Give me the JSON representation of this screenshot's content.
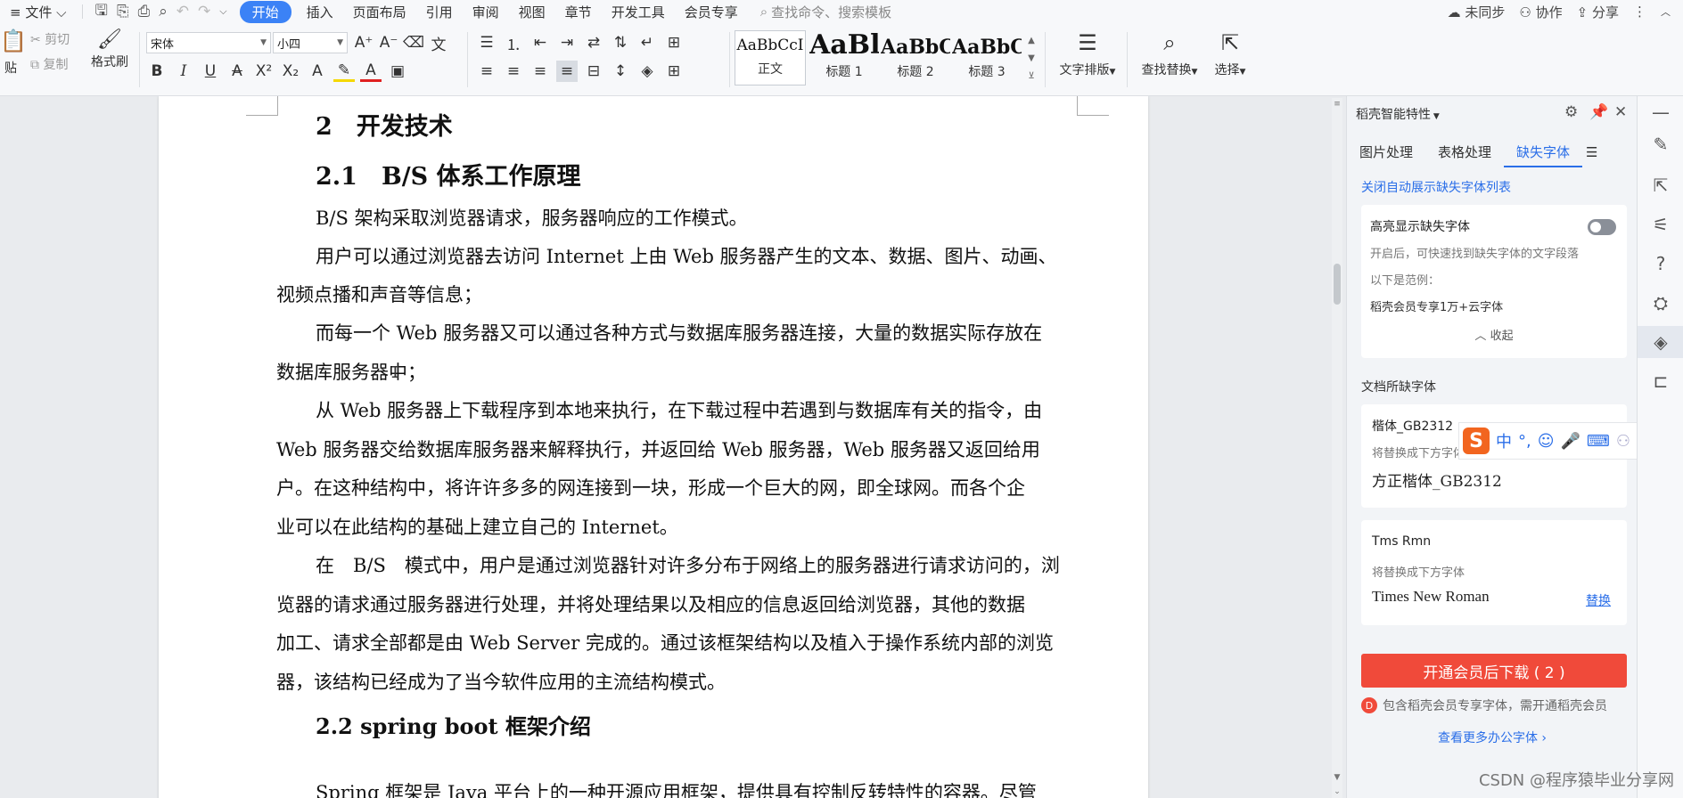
{
  "menubar": {
    "file": "文件",
    "tabs": [
      "开始",
      "插入",
      "页面布局",
      "引用",
      "审阅",
      "视图",
      "章节",
      "开发工具",
      "会员专享"
    ],
    "active_tab": "开始",
    "search_placeholder": "查找命令、搜索模板",
    "sync": "未同步",
    "collab": "协作",
    "share": "分享"
  },
  "ribbon": {
    "paste": "贴",
    "cut": "剪切",
    "copy": "复制",
    "format_painter": "格式刷",
    "font_name": "宋体",
    "font_size": "小四",
    "styles": [
      {
        "preview": "AaBbCcI",
        "label": "正文"
      },
      {
        "preview": "AaBl",
        "label": "标题 1"
      },
      {
        "preview": "AaBbC",
        "label": "标题 2"
      },
      {
        "preview": "AaBbC",
        "label": "标题 3"
      }
    ],
    "text_layout": "文字排版",
    "find_replace": "查找替换",
    "select": "选择"
  },
  "document": {
    "h_chapter": "2　开发技术",
    "h_section": "2.1　B/S 体系工作原理",
    "lines": [
      "B/S 架构采取浏览器请求，服务器响应的工作模式。",
      "用户可以通过浏览器去访问 Internet 上由 Web 服务器产生的文本、数据、图片、动画、",
      "视频点播和声音等信息；",
      "而每一个 Web 服务器又可以通过各种方式与数据库服务器连接，大量的数据实际存放在",
      "数据库服务器中；",
      "从 Web 服务器上下载程序到本地来执行，在下载过程中若遇到与数据库有关的指令，由",
      "Web 服务器交给数据库服务器来解释执行，并返回给 Web 服务器，Web 服务器又返回给用",
      "户。在这种结构中，将许许多多的网连接到一块，形成一个巨大的网，即全球网。而各个企",
      "业可以在此结构的基础上建立自己的 Internet。",
      "在　B/S　模式中，用户是通过浏览器针对许多分布于网络上的服务器进行请求访问的，浏",
      "览器的请求通过服务器进行处理，并将处理结果以及相应的信息返回给浏览器，其他的数据",
      "加工、请求全部都是由 Web Server 完成的。通过该框架结构以及植入于操作系统内部的浏览",
      "器，该结构已经成为了当今软件应用的主流结构模式。"
    ],
    "h_sub": "2.2 spring boot 框架介绍",
    "last_line": "Spring 框架是 Java 平台上的一种开源应用框架，提供具有控制反转特性的容器。尽管"
  },
  "pane": {
    "title": "稻壳智能特性",
    "tabs": [
      "图片处理",
      "表格处理",
      "缺失字体"
    ],
    "active_tab": "缺失字体",
    "close_auto_link": "关闭自动展示缺失字体列表",
    "highlight_title": "高亮显示缺失字体",
    "highlight_desc": "开启后，可快速找到缺失字体的文字段落",
    "example_label": "以下是范例：",
    "example_value": "稻壳会员专享1万+云字体",
    "collapse": "收起",
    "missing_title": "文档所缺字体",
    "missing_fonts": [
      {
        "name": "楷体_GB2312",
        "replace_label": "将替换成下方字体",
        "replacement": "方正楷体_GB2312"
      },
      {
        "name": "Tms Rmn",
        "replace_label": "将替换成下方字体",
        "replacement": "Times New Roman",
        "action": "替换"
      }
    ],
    "download_button": "开通会员后下载 ( 2 )",
    "member_note": "包含稻壳会员专享字体，需开通稻壳会员",
    "more_fonts_link": "查看更多办公字体 ›"
  },
  "ime": {
    "mode": "中"
  },
  "watermark": "CSDN @程序猿毕业分享网",
  "colors": {
    "accent": "#3b82f6",
    "download_red": "#f04a3a",
    "link_blue": "#2a6ee8"
  }
}
